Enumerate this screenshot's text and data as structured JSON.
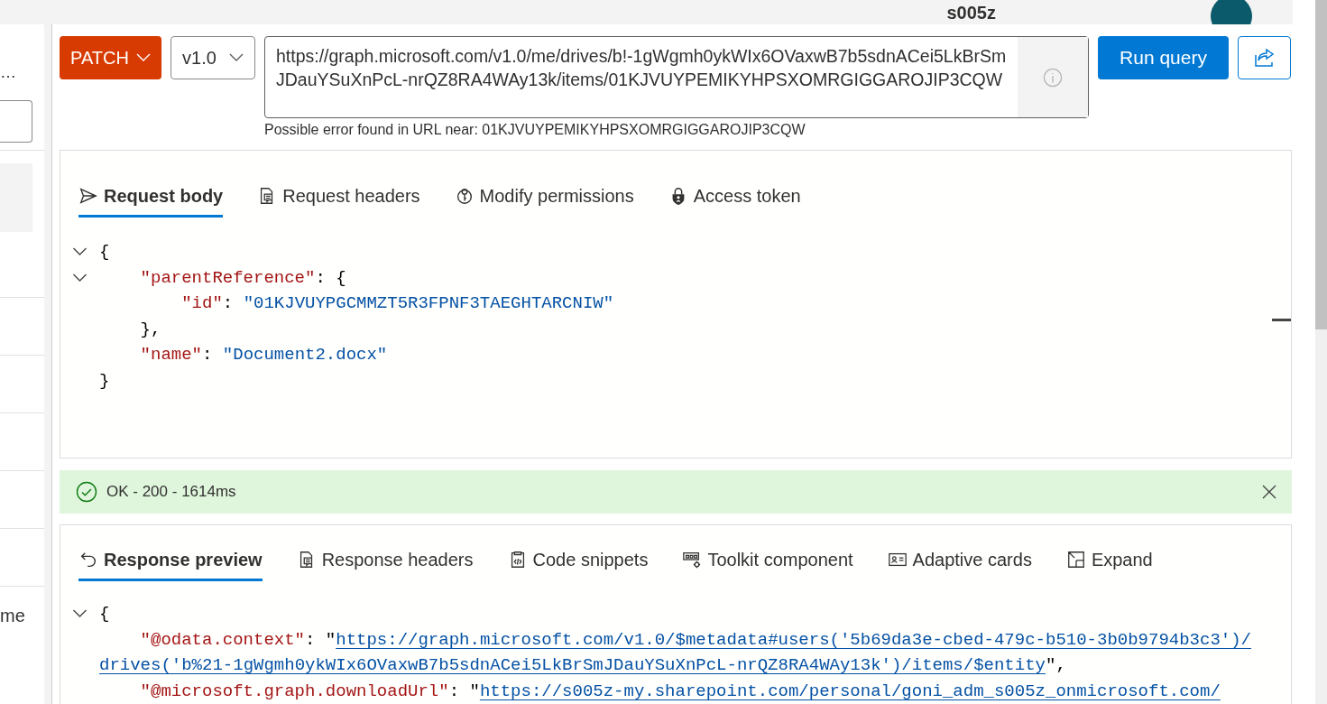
{
  "header": {
    "user": "s005z"
  },
  "sidebar": {
    "truncated_text": "…",
    "rows": [
      {
        "label": "me"
      }
    ]
  },
  "query_bar": {
    "method": "PATCH",
    "version": "v1.0",
    "url": "https://graph.microsoft.com/v1.0/me/drives/b!-1gWgmh0ykWIx6OVaxwB7b5sdnACei5LkBrSmJDauYSuXnPcL-nrQZ8RA4WAy13k/items/01KJVUYPEMIKYHPSXOMRGIGGAROJIP3CQW",
    "run_label": "Run query",
    "url_error": "Possible error found in URL near: 01KJVUYPEMIKYHPSXOMRGIGGAROJIP3CQW"
  },
  "request_tabs": [
    {
      "label": "Request body",
      "selected": true
    },
    {
      "label": "Request headers",
      "selected": false
    },
    {
      "label": "Modify permissions",
      "selected": false
    },
    {
      "label": "Access token",
      "selected": false
    }
  ],
  "request_body": [
    {
      "fold": true,
      "tokens": [
        {
          "kind": "punct",
          "text": "{"
        }
      ],
      "children": [
        {
          "fold": true,
          "tokens": [
            {
              "kind": "key",
              "text": "\"parentReference\""
            },
            {
              "kind": "punct",
              "text": ": {"
            }
          ],
          "children": [
            {
              "fold": false,
              "tokens": [
                {
                  "kind": "key",
                  "text": "\"id\""
                },
                {
                  "kind": "punct",
                  "text": ": "
                },
                {
                  "kind": "string",
                  "text": "\"01KJVUYPGCMMZT5R3FPNF3TAEGHTARCNIW\""
                }
              ]
            }
          ]
        },
        {
          "fold": false,
          "tokens": [
            {
              "kind": "punct",
              "text": "},"
            }
          ]
        },
        {
          "fold": false,
          "tokens": [
            {
              "kind": "key",
              "text": "\"name\""
            },
            {
              "kind": "punct",
              "text": ": "
            },
            {
              "kind": "string",
              "text": "\"Document2.docx\""
            }
          ]
        }
      ]
    },
    {
      "fold": false,
      "tokens": [
        {
          "kind": "punct",
          "text": "}"
        }
      ]
    }
  ],
  "status": {
    "text": "OK - 200 - 1614ms",
    "success": true
  },
  "response_tabs": [
    {
      "label": "Response preview",
      "selected": true
    },
    {
      "label": "Response headers",
      "selected": false
    },
    {
      "label": "Code snippets",
      "selected": false
    },
    {
      "label": "Toolkit component",
      "selected": false
    },
    {
      "label": "Adaptive cards",
      "selected": false
    },
    {
      "label": "Expand",
      "selected": false
    }
  ],
  "response_body": [
    {
      "fold": true,
      "tokens": [
        {
          "kind": "punct",
          "text": "{"
        }
      ],
      "children": [
        {
          "fold": false,
          "tokens": [
            {
              "kind": "key",
              "text": "\"@odata.context\""
            },
            {
              "kind": "punct",
              "text": ": \""
            },
            {
              "kind": "link",
              "text": "https://graph.microsoft.com/v1.0/$metadata#users('5b69da3e-cbed-479c-b510-3b0b9794b3c3')/drives('b%21-1gWgmh0ykWIx6OVaxwB7b5sdnACei5LkBrSmJDauYSuXnPcL-nrQZ8RA4WAy13k')/items/$entity"
            },
            {
              "kind": "punct",
              "text": "\","
            }
          ]
        },
        {
          "fold": false,
          "tokens": [
            {
              "kind": "key",
              "text": "\"@microsoft.graph.downloadUrl\""
            },
            {
              "kind": "punct",
              "text": ": \""
            },
            {
              "kind": "link",
              "text": "https://s005z-my.sharepoint.com/personal/goni_adm_s005z_onmicrosoft.com/"
            }
          ]
        }
      ]
    }
  ]
}
